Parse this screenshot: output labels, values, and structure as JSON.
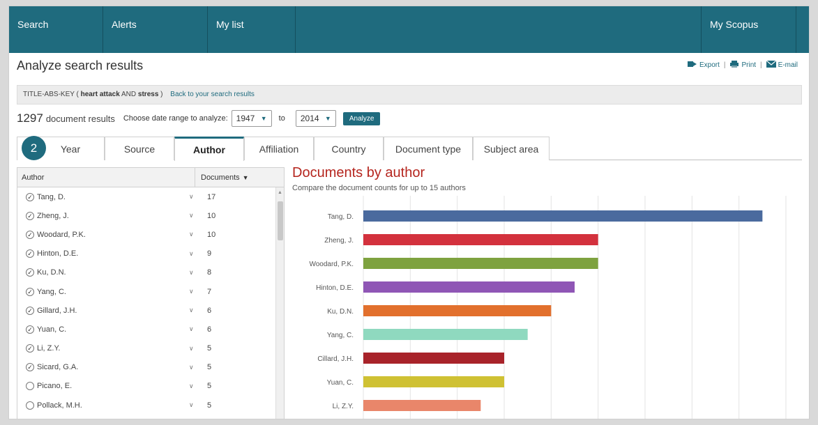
{
  "nav": {
    "search": "Search",
    "alerts": "Alerts",
    "mylist": "My list",
    "myscopus": "My Scopus"
  },
  "page": {
    "title": "Analyze search results",
    "export": "Export",
    "print": "Print",
    "email": "E-mail"
  },
  "query": {
    "prefix": "TITLE-ABS-KEY (",
    "term1": "heart attack",
    "op": "AND",
    "term2": "stress",
    "suffix": ")",
    "back_link": "Back to your search results"
  },
  "results": {
    "count": "1297",
    "label": "document results",
    "range_label": "Choose date range to analyze:",
    "from_year": "1947",
    "to_label": "to",
    "to_year": "2014",
    "analyze_button": "Analyze"
  },
  "step_badge": "2",
  "tabs": [
    {
      "label": "Year"
    },
    {
      "label": "Source"
    },
    {
      "label": "Author"
    },
    {
      "label": "Affiliation"
    },
    {
      "label": "Country"
    },
    {
      "label": "Document type"
    },
    {
      "label": "Subject area"
    }
  ],
  "author_table": {
    "header_author": "Author",
    "header_documents": "Documents",
    "rows": [
      {
        "name": "Tang, D.",
        "count": "17",
        "checked": true
      },
      {
        "name": "Zheng, J.",
        "count": "10",
        "checked": true
      },
      {
        "name": "Woodard, P.K.",
        "count": "10",
        "checked": true
      },
      {
        "name": "Hinton, D.E.",
        "count": "9",
        "checked": true
      },
      {
        "name": "Ku, D.N.",
        "count": "8",
        "checked": true
      },
      {
        "name": "Yang, C.",
        "count": "7",
        "checked": true
      },
      {
        "name": "Gillard, J.H.",
        "count": "6",
        "checked": true
      },
      {
        "name": "Yuan, C.",
        "count": "6",
        "checked": true
      },
      {
        "name": "Li, Z.Y.",
        "count": "5",
        "checked": true
      },
      {
        "name": "Sicard, G.A.",
        "count": "5",
        "checked": true
      },
      {
        "name": "Picano, E.",
        "count": "5",
        "checked": false
      },
      {
        "name": "Pollack, M.H.",
        "count": "5",
        "checked": false
      }
    ]
  },
  "chart_data": {
    "type": "bar",
    "orientation": "horizontal",
    "title": "Documents by author",
    "subtitle": "Compare the document counts for up to 15 authors",
    "categories": [
      "Tang, D.",
      "Zheng, J.",
      "Woodard, P.K.",
      "Hinton, D.E.",
      "Ku, D.N.",
      "Yang, C.",
      "Cillard, J.H.",
      "Yuan, C.",
      "Li, Z.Y."
    ],
    "values": [
      17,
      10,
      10,
      9,
      8,
      7,
      6,
      6,
      5
    ],
    "colors": [
      "#4a6a9e",
      "#d3313d",
      "#7ea23f",
      "#8f56b5",
      "#e2702d",
      "#8fd9bf",
      "#a8232a",
      "#cfc133",
      "#e9866a"
    ],
    "xlim": [
      0,
      18
    ],
    "grid": true
  }
}
